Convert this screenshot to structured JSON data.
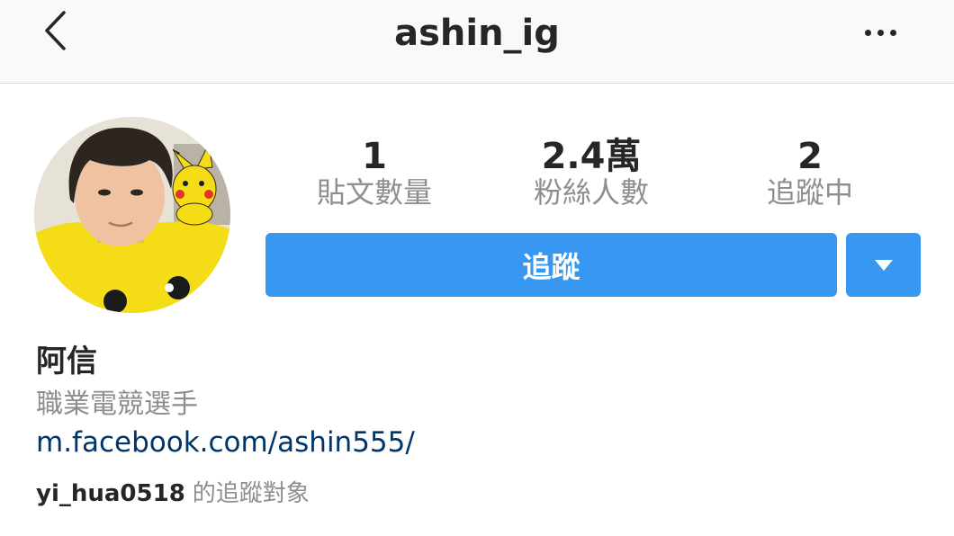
{
  "header": {
    "username": "ashin_ig"
  },
  "stats": {
    "posts_count": "1",
    "posts_label": "貼文數量",
    "followers_count": "2.4萬",
    "followers_label": "粉絲人數",
    "following_count": "2",
    "following_label": "追蹤中"
  },
  "actions": {
    "follow_label": "追蹤"
  },
  "bio": {
    "name": "阿信",
    "description": "職業電競選手",
    "link": "m.facebook.com/ashin555/",
    "followed_by_user": "yi_hua0518",
    "followed_by_suffix": "的追蹤對象"
  },
  "colors": {
    "primary_button": "#3897f0",
    "link": "#003569",
    "muted_text": "#8e8e8e",
    "main_text": "#262626"
  },
  "icons": {
    "back": "chevron-left-icon",
    "more": "more-horizontal-icon",
    "dropdown": "triangle-down-icon"
  }
}
